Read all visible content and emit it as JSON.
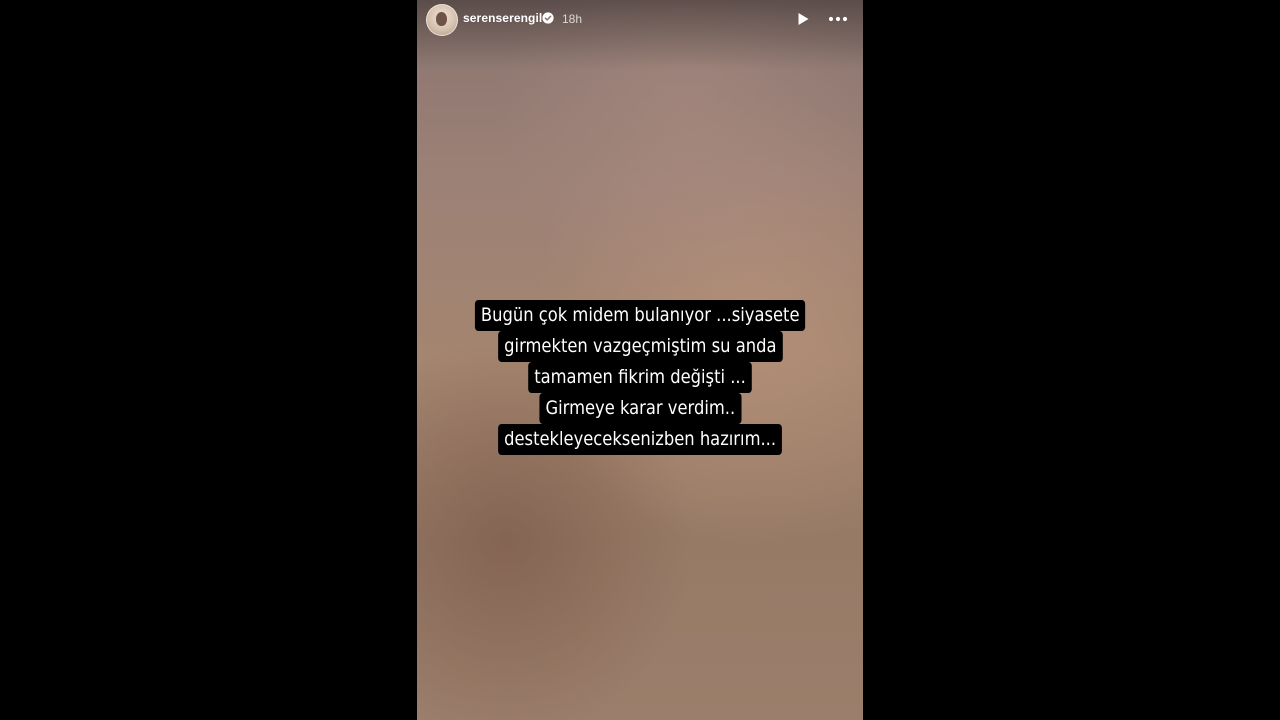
{
  "story": {
    "username": "serenserengil",
    "verified": true,
    "time_ago": "18h",
    "icons": {
      "avatar": "profile-avatar",
      "verified": "verified-badge-icon",
      "play": "play-icon",
      "more": "more-options-icon"
    },
    "caption_lines": [
      "Bugün  çok  midem bulanıyor ...siyasete",
      "girmekten vazgeçmiştim  su anda",
      "tamamen fikrim değişti  ...",
      "Girmeye karar verdim..",
      "destekleyeceksenizben hazırım..."
    ]
  },
  "colors": {
    "background": "#000000",
    "caption_bg": "#000000",
    "caption_text": "#ffffff",
    "header_text": "#ffffff"
  }
}
